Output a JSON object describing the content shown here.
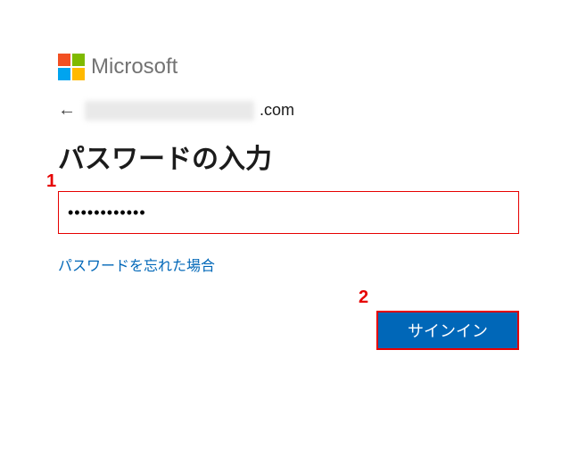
{
  "brand": "Microsoft",
  "identity": {
    "suffix": ".com"
  },
  "title": "パスワードの入力",
  "password": {
    "value": "••••••••••••",
    "placeholder": ""
  },
  "forgot_link": "パスワードを忘れた場合",
  "signin_button": "サインイン",
  "annotations": {
    "one": "1",
    "two": "2"
  }
}
